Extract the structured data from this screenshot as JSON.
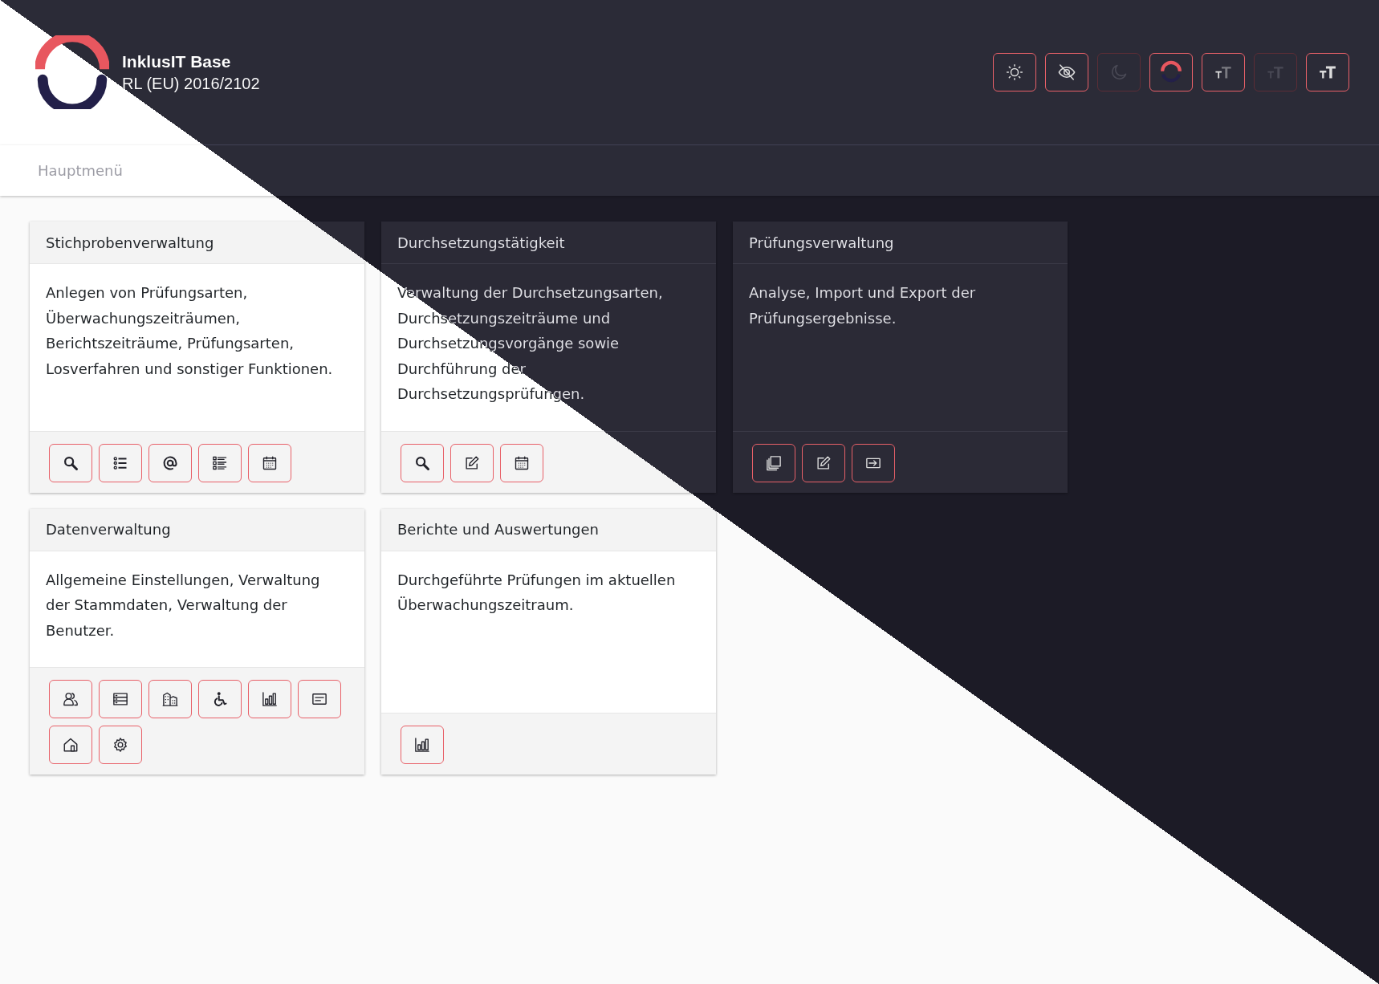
{
  "header": {
    "title": "InklusIT Base",
    "subtitle": "RL (EU) 2016/2102",
    "tools": [
      {
        "kind": "sun",
        "disabled": false
      },
      {
        "kind": "eye-off",
        "disabled": false
      },
      {
        "kind": "moon",
        "disabled": true
      },
      {
        "kind": "logo",
        "disabled": false
      },
      {
        "kind": "text-larger",
        "disabled": false
      },
      {
        "kind": "text-smaller",
        "disabled": true
      },
      {
        "kind": "text-bold",
        "disabled": false
      }
    ]
  },
  "breadcrumb": "Hauptmenü",
  "cards": [
    {
      "title": "Stichprobenverwaltung",
      "text": "Anlegen von Prüfungsarten, Überwachungszeiträumen, Berichtszeiträume, Prüfungsarten, Losverfahren und sonstiger Funktionen.",
      "buttons": [
        {
          "kind": "search"
        },
        {
          "kind": "list-circles"
        },
        {
          "kind": "at"
        },
        {
          "kind": "list-squares"
        },
        {
          "kind": "calendar"
        }
      ]
    },
    {
      "title": "Durchsetzungstätigkeit",
      "text": "Verwaltung der Durchsetzungsarten, Durchsetzungszeiträume und Durchsetzungsvorgänge sowie Durchführung der Durchsetzungsprüfungen.",
      "buttons": [
        {
          "kind": "search"
        },
        {
          "kind": "edit"
        },
        {
          "kind": "calendar"
        }
      ]
    },
    {
      "title": "Prüfungsverwaltung",
      "text": "Analyse, Import und Export der Prüfungsergebnisse.",
      "buttons": [
        {
          "kind": "copy"
        },
        {
          "kind": "edit"
        },
        {
          "kind": "enter"
        }
      ]
    },
    {
      "title": "Datenverwaltung",
      "text": "Allgemeine Einstellungen, Verwaltung der Stammdaten, Verwaltung der Benutzer.",
      "buttons": [
        {
          "kind": "people"
        },
        {
          "kind": "rows"
        },
        {
          "kind": "buildings"
        },
        {
          "kind": "wheelchair"
        },
        {
          "kind": "bar-chart"
        },
        {
          "kind": "card-text"
        },
        {
          "kind": "house"
        },
        {
          "kind": "gear"
        }
      ]
    },
    {
      "title": "Berichte und Auswertungen",
      "text": "Durchgeführte Prüfungen im aktuellen Überwachungszeitraum.",
      "buttons": [
        {
          "kind": "bar-chart"
        }
      ]
    }
  ]
}
